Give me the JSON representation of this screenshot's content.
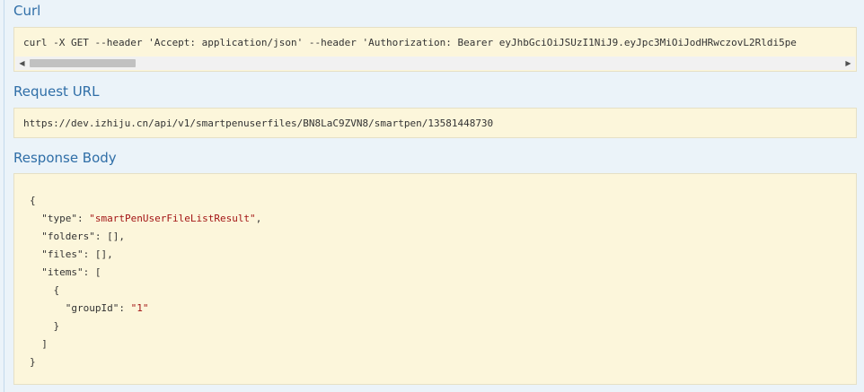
{
  "curl": {
    "heading": "Curl",
    "command": "curl -X GET --header 'Accept: application/json' --header 'Authorization: Bearer eyJhbGciOiJSUzI1NiJ9.eyJpc3MiOiJodHRwczovL2Rldi5pe",
    "scroll_left_icon": "triangle-left",
    "scroll_right_icon": "triangle-right"
  },
  "request_url": {
    "heading": "Request URL",
    "value": "https://dev.izhiju.cn/api/v1/smartpenuserfiles/BN8LaC9ZVN8/smartpen/13581448730"
  },
  "response_body": {
    "heading": "Response Body",
    "lines": {
      "open": "{",
      "type_key": "\"type\"",
      "type_value": "\"smartPenUserFileListResult\"",
      "folders_key": "\"folders\"",
      "folders_value": "[]",
      "files_key": "\"files\"",
      "files_value": "[]",
      "items_key": "\"items\"",
      "items_open": "[",
      "item_open": "{",
      "groupid_key": "\"groupId\"",
      "groupid_value": "\"1\"",
      "item_close": "}",
      "items_close": "]",
      "close": "}"
    }
  }
}
